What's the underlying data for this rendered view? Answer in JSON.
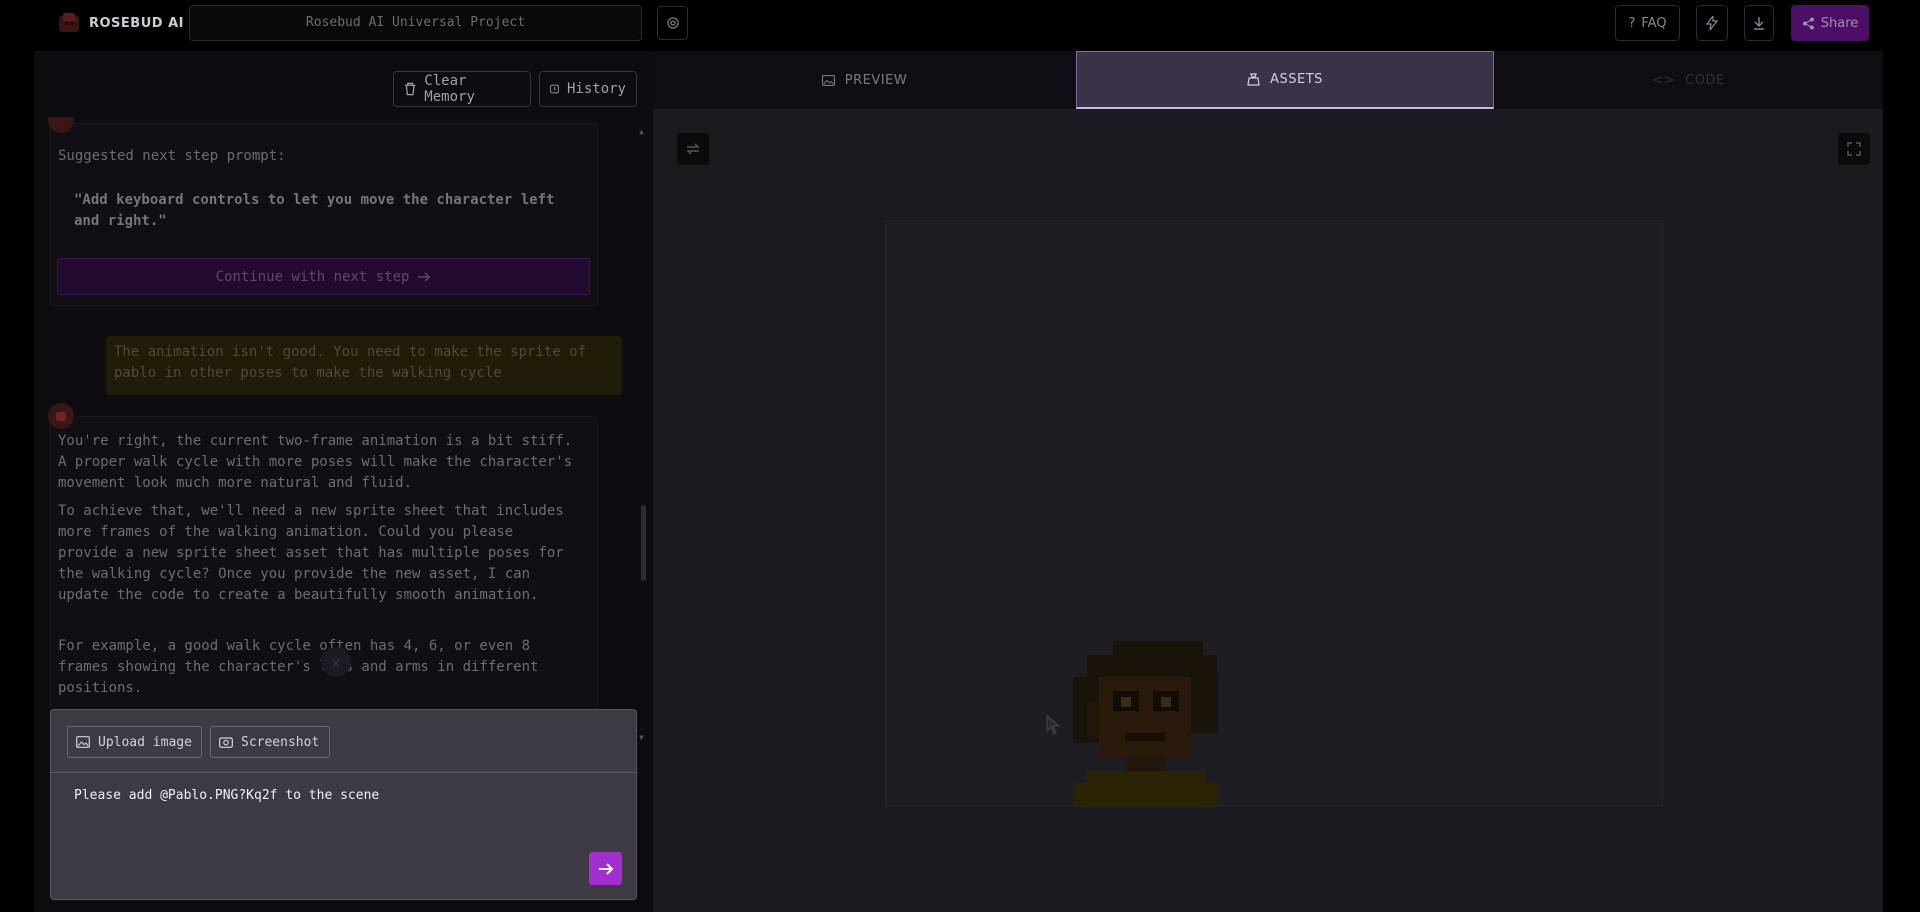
{
  "app": {
    "name": "ROSEBUD AI"
  },
  "project": {
    "name": "Rosebud AI Universal Project"
  },
  "topbar": {
    "faq_label": "FAQ",
    "share_label": "Share"
  },
  "chat": {
    "clear_memory_label": "Clear Memory",
    "history_label": "History",
    "suggested_label": "Suggested next step prompt:",
    "suggested_prompt": "\"Add keyboard controls to let you move the character left and right.\"",
    "continue_label": "Continue with next step",
    "user_message": "The animation isn't good. You need to make the sprite of pablo in other poses to make the walking cycle",
    "assistant_paragraphs": [
      "You're right, the current two-frame animation is a bit stiff. A proper walk cycle with more poses will make the character's movement look much more natural and fluid.",
      "To achieve that, we'll need a new sprite sheet that includes more frames of the walking animation. Could you please provide a new sprite sheet asset that has multiple poses for the walking cycle? Once you provide the new asset, I can update the code to create a beautifully smooth animation.",
      "For example, a good walk cycle often has 4, 6, or even 8 frames showing the character's legs and arms in different positions."
    ]
  },
  "composer": {
    "upload_label": "Upload image",
    "screenshot_label": "Screenshot",
    "prompt_value": "Please add @Pablo.PNG?Kq2f to the scene"
  },
  "tabs": [
    {
      "label": "PREVIEW"
    },
    {
      "label": "ASSETS"
    },
    {
      "label": "CODE"
    }
  ],
  "colors": {
    "accent": "#a12fce",
    "active_tab": "#3a3246",
    "share_bg": "#4b0f66",
    "panel_bg": "#3e3a44"
  }
}
